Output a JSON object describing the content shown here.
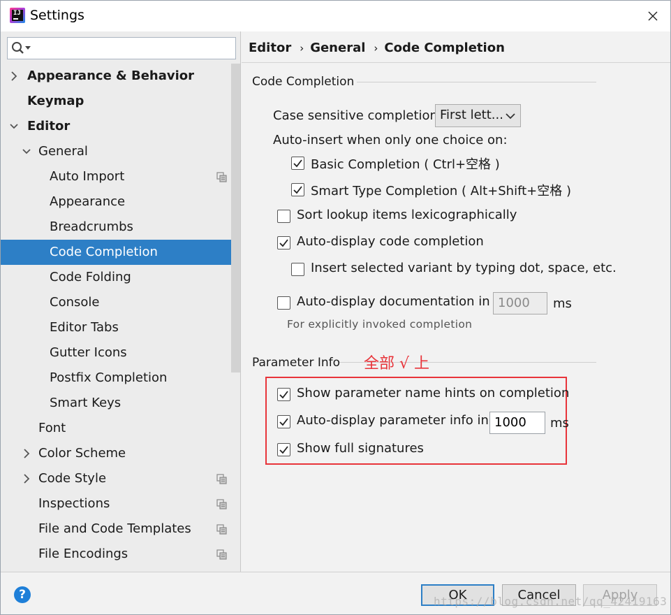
{
  "window": {
    "title": "Settings"
  },
  "search": {
    "value": ""
  },
  "tree": [
    {
      "label": "Appearance & Behavior",
      "bold": true,
      "expanded": false,
      "has_chevron": true
    },
    {
      "label": "Keymap",
      "bold": true
    },
    {
      "label": "Editor",
      "bold": true,
      "expanded": true,
      "has_chevron": true
    },
    {
      "label": "General",
      "expanded": true,
      "has_chevron": true
    },
    {
      "label": "Auto Import",
      "project_icon": true
    },
    {
      "label": "Appearance"
    },
    {
      "label": "Breadcrumbs"
    },
    {
      "label": "Code Completion",
      "selected": true
    },
    {
      "label": "Code Folding"
    },
    {
      "label": "Console"
    },
    {
      "label": "Editor Tabs"
    },
    {
      "label": "Gutter Icons"
    },
    {
      "label": "Postfix Completion"
    },
    {
      "label": "Smart Keys"
    },
    {
      "label": "Font"
    },
    {
      "label": "Color Scheme",
      "has_chevron": true
    },
    {
      "label": "Code Style",
      "has_chevron": true,
      "project_icon": true
    },
    {
      "label": "Inspections",
      "project_icon": true
    },
    {
      "label": "File and Code Templates",
      "project_icon": true
    },
    {
      "label": "File Encodings",
      "project_icon": true
    }
  ],
  "breadcrumb": [
    "Editor",
    "General",
    "Code Completion"
  ],
  "code_completion": {
    "group_title": "Code Completion",
    "case_sensitive_label": "Case sensitive completion:",
    "case_sensitive_value": "First lett...",
    "auto_insert_label": "Auto-insert when only one choice on:",
    "basic_completion": {
      "label": "Basic Completion ( Ctrl+空格 )",
      "checked": true
    },
    "smart_type_completion": {
      "label": "Smart Type Completion ( Alt+Shift+空格 )",
      "checked": true
    },
    "sort_lookup": {
      "label": "Sort lookup items lexicographically",
      "checked": false
    },
    "auto_display_completion": {
      "label": "Auto-display code completion",
      "checked": true
    },
    "insert_selected_variant": {
      "label": "Insert selected variant by typing dot, space, etc.",
      "checked": false
    },
    "auto_display_documentation": {
      "label": "Auto-display documentation in",
      "checked": false,
      "value": "1000",
      "unit": "ms"
    },
    "documentation_hint": "For explicitly invoked completion"
  },
  "parameter_info": {
    "group_title": "Parameter Info",
    "annotation": "全部 √ 上",
    "show_name_hints": {
      "label": "Show parameter name hints on completion",
      "checked": true
    },
    "auto_display_param_info": {
      "label": "Auto-display parameter info in",
      "checked": true,
      "value": "1000",
      "unit": "ms"
    },
    "show_full_signatures": {
      "label": "Show full signatures",
      "checked": true
    }
  },
  "buttons": {
    "help": "?",
    "ok": "OK",
    "cancel": "Cancel",
    "apply": "Apply"
  },
  "watermark": "https://blog.csdn.net/qq_42419163",
  "colors": {
    "selection": "#2d7fc6",
    "annotation": "#e8343a"
  }
}
